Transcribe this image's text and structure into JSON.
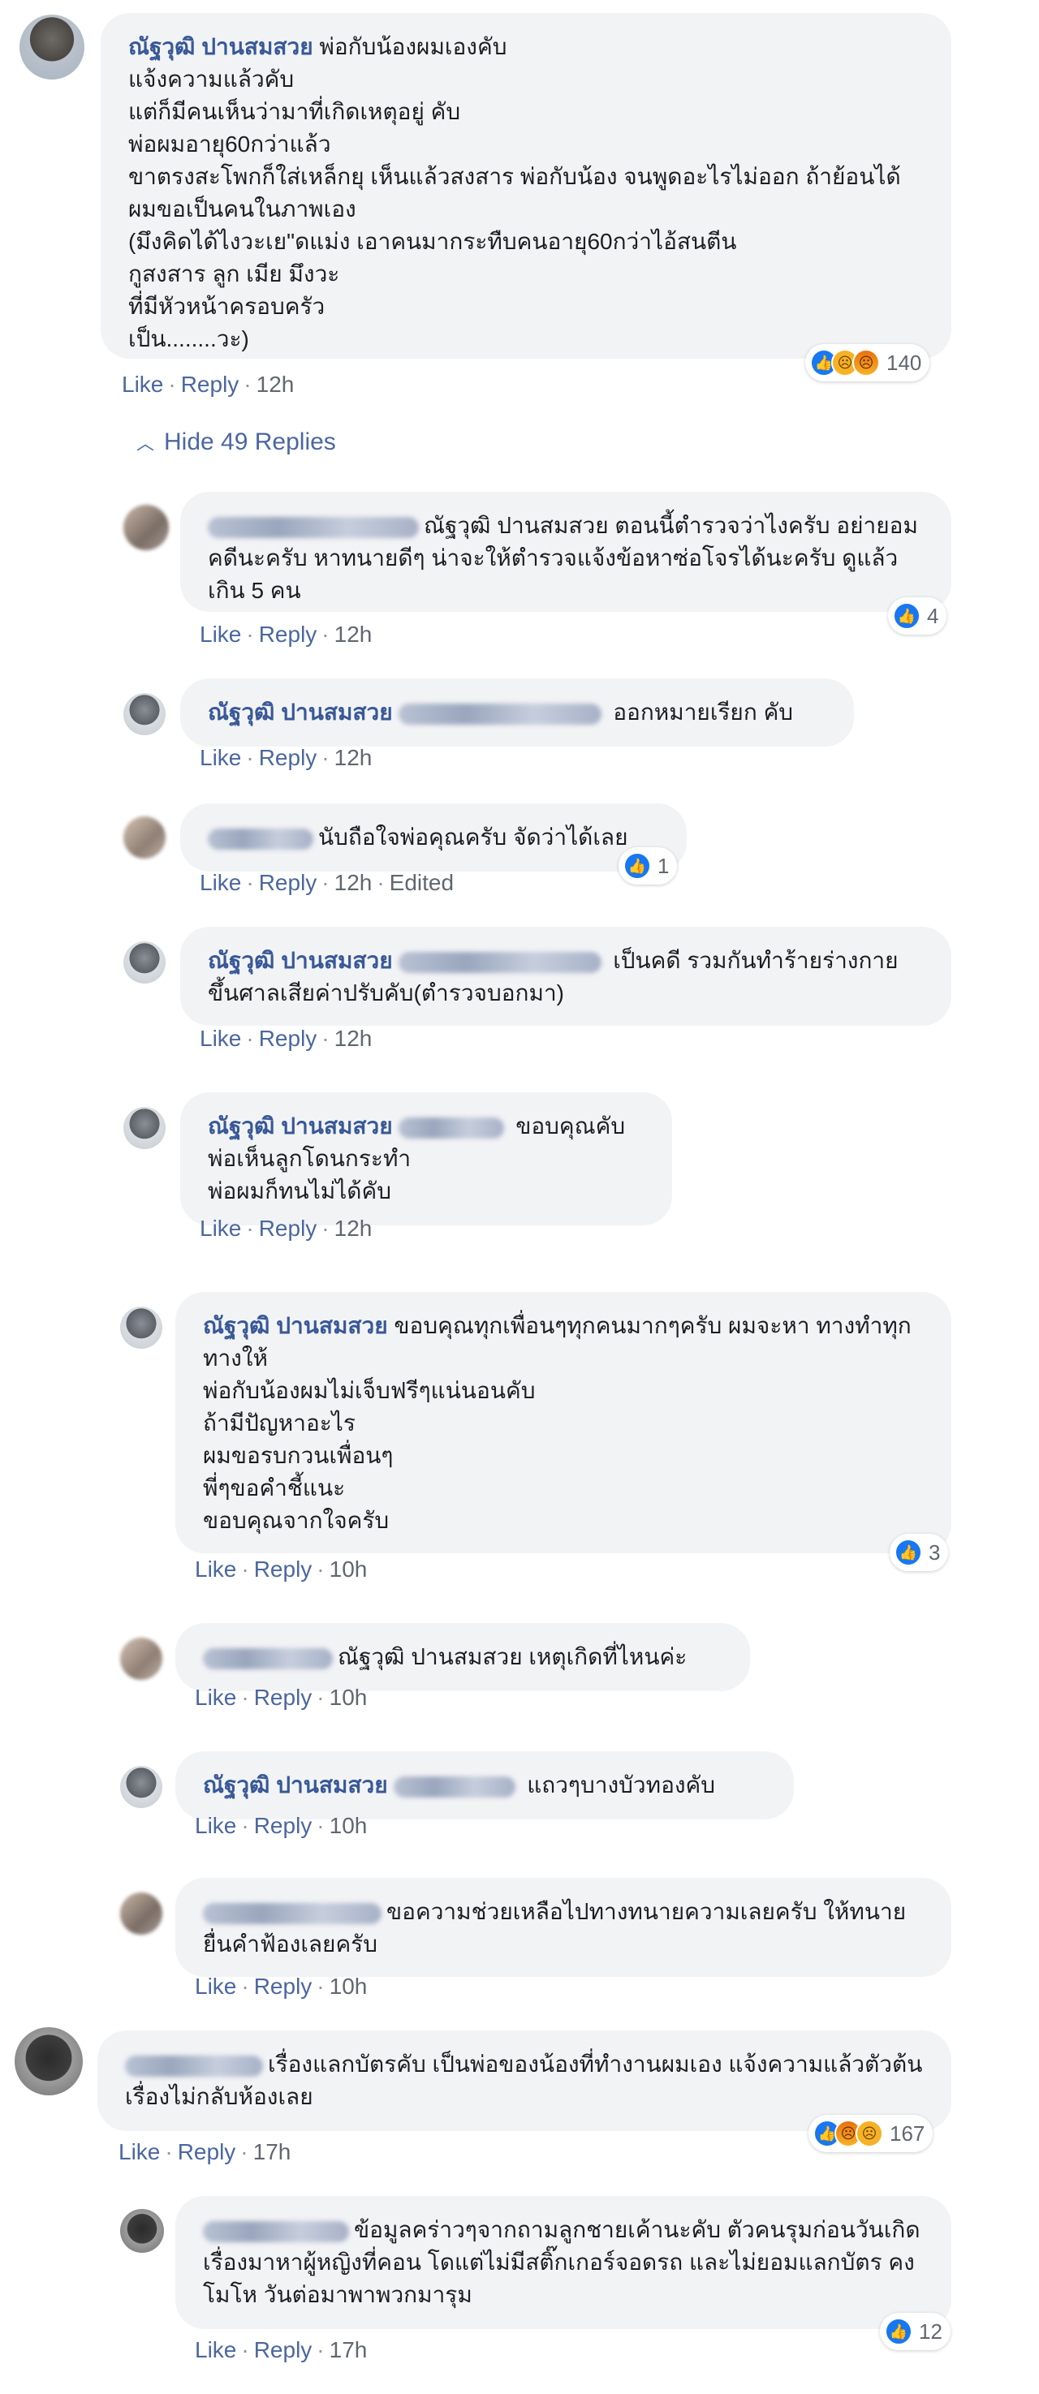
{
  "ui": {
    "like_label": "Like",
    "reply_label": "Reply",
    "edited_label": "Edited",
    "hide_replies_label": "Hide 49 Replies"
  },
  "comments": [
    {
      "author": "ณัฐวุฒิ ปานสมสวย",
      "text": "พ่อกับน้องผมเองคับ\nแจ้งความแล้วคับ\nแต่ก็มีคนเห็นว่ามาที่เกิดเหตุอยู่ คับ\nพ่อผมอายุ60กว่าแล้ว\nขาตรงสะโพกก็ใส่เหล็กยุ เห็นแล้วสงสาร พ่อกับน้อง จนพูดอะไรไม่ออก ถ้าย้อนได้ผมขอเป็นคนในภาพเอง\n(มึงคิดได้ไงวะเย\"ดแม่ง เอาคนมากระทืบคนอายุ60กว่าไอ้สนตีน\nกูสงสาร ลูก เมีย มึงวะ\nที่มีหัวหน้าครอบครัว\nเป็น........วะ)",
      "time": "12h",
      "reactions": [
        "like-icon",
        "sad-icon",
        "angry-icon"
      ],
      "count": "140"
    },
    {
      "author": "",
      "text": "ณัฐวุฒิ ปานสมสวย ตอนนี้ตำรวจว่าไงครับ อย่ายอมคดีนะครับ หาทนายดีๆ น่าจะให้ตำรวจแจ้งข้อหาซ่อโจรได้นะครับ ดูแล้วเกิน 5 คน",
      "time": "12h",
      "count": "4"
    },
    {
      "author": "ณัฐวุฒิ ปานสมสวย",
      "text": "ออกหมายเรียก คับ",
      "time": "12h"
    },
    {
      "author": "",
      "text": "นับถือใจพ่อคุณครับ จัดว่าได้เลย",
      "time": "12h",
      "count": "1"
    },
    {
      "author": "ณัฐวุฒิ ปานสมสวย",
      "text": "เป็นคดี รวมกันทำร้ายร่างกาย ขึ้นศาลเสียค่าปรับคับ(ตำรวจบอกมา)",
      "time": "12h"
    },
    {
      "author": "ณัฐวุฒิ ปานสมสวย",
      "text": "ขอบคุณคับ\nพ่อเห็นลูกโดนกระทำ\nพ่อผมก็ทนไม่ได้คับ",
      "time": "12h"
    },
    {
      "author": "ณัฐวุฒิ ปานสมสวย",
      "text": "ขอบคุณทุกเพื่อนๆทุกคนมากๆครับ ผมจะหา ทางทำทุกทางให้\nพ่อกับน้องผมไม่เจ็บฟรีๆแน่นอนคับ\nถ้ามีปัญหาอะไร\nผมขอรบกวนเพื่อนๆ\nพี่ๆขอคำชี้แนะ\nขอบคุณจากใจครับ",
      "time": "10h",
      "count": "3"
    },
    {
      "author": "",
      "text": "ณัฐวุฒิ ปานสมสวย เหตุเกิดที่ไหนค่ะ",
      "time": "10h"
    },
    {
      "author": "ณัฐวุฒิ ปานสมสวย",
      "text": "แถวๆบางบัวทองคับ",
      "time": "10h"
    },
    {
      "author": "",
      "text": "ขอความช่วยเหลือไปทางทนายความเลยครับ ให้ทนายยื่นคำฟ้องเลยครับ",
      "time": "10h"
    },
    {
      "author": "",
      "text": "เรื่องแลกบัตรคับ เป็นพ่อของน้องที่ทำงานผมเอง แจ้งความแล้วตัวต้นเรื่องไม่กลับห้องเลย",
      "time": "17h",
      "reactions": [
        "like-icon",
        "angry-icon",
        "sad-icon"
      ],
      "count": "167"
    },
    {
      "author": "",
      "text": "ข้อมูลคร่าวๆจากถามลูกชายเค้านะคับ ตัวคนรุมก่อนวันเกิดเรื่องมาหาผู้หญิงที่คอน โดแต่ไม่มีสติ๊กเกอร์จอดรถ และไม่ยอมแลกบัตร คงโมโห วันต่อมาพาพวกมารุม",
      "time": "17h",
      "count": "12"
    }
  ]
}
